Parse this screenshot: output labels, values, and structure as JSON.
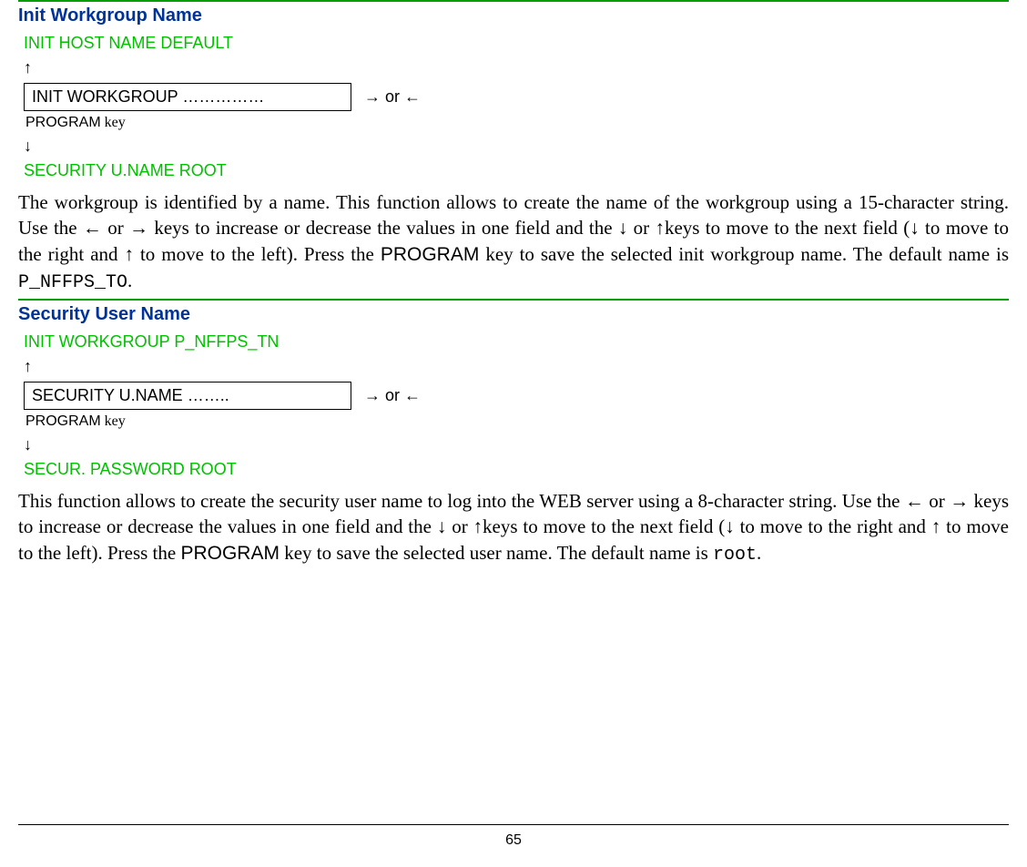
{
  "section1": {
    "title": "Init Workgroup Name",
    "above": "INIT HOST NAME DEFAULT",
    "up_arrow": "↑",
    "boxed": "INIT WORKGROUP ……………",
    "side_arrows": "→ or ←",
    "prog_word": "PROGRAM",
    "prog_key": " key",
    "down_arrow": "↓",
    "below": "SECURITY U.NAME ROOT",
    "body_pre": "The workgroup is identified by a name. This function allows to create the name of the workgroup using a 15-character string. Use the ← or → keys to increase or decrease the values in one field and the ↓ or ↑keys to move to the next field (↓ to move to the right and ↑ to move to the left). Press the ",
    "body_prog": "PROGRAM",
    "body_mid": " key to save the selected init workgroup name. The default name is ",
    "body_mono": "P_NFFPS_TO",
    "body_end": "."
  },
  "section2": {
    "title": "Security User Name",
    "above": "INIT WORKGROUP P_NFFPS_TN",
    "up_arrow": "↑",
    "boxed": "SECURITY U.NAME  ……..",
    "side_arrows": "→ or ←",
    "prog_word": "PROGRAM",
    "prog_key": " key",
    "down_arrow": "↓",
    "below": "SECUR.  PASSWORD ROOT",
    "body_pre": "This function allows to create the security user name to log into the WEB server using a 8-character string. Use the ← or → keys to increase or decrease the values in one field and the ↓ or ↑keys to move to the next field (↓ to move to the right and ↑ to move to the left). Press the ",
    "body_prog": "PROGRAM",
    "body_mid": " key to save the selected user name. The default name is ",
    "body_mono": "root",
    "body_end": "."
  },
  "footer": {
    "page_number": "65"
  }
}
